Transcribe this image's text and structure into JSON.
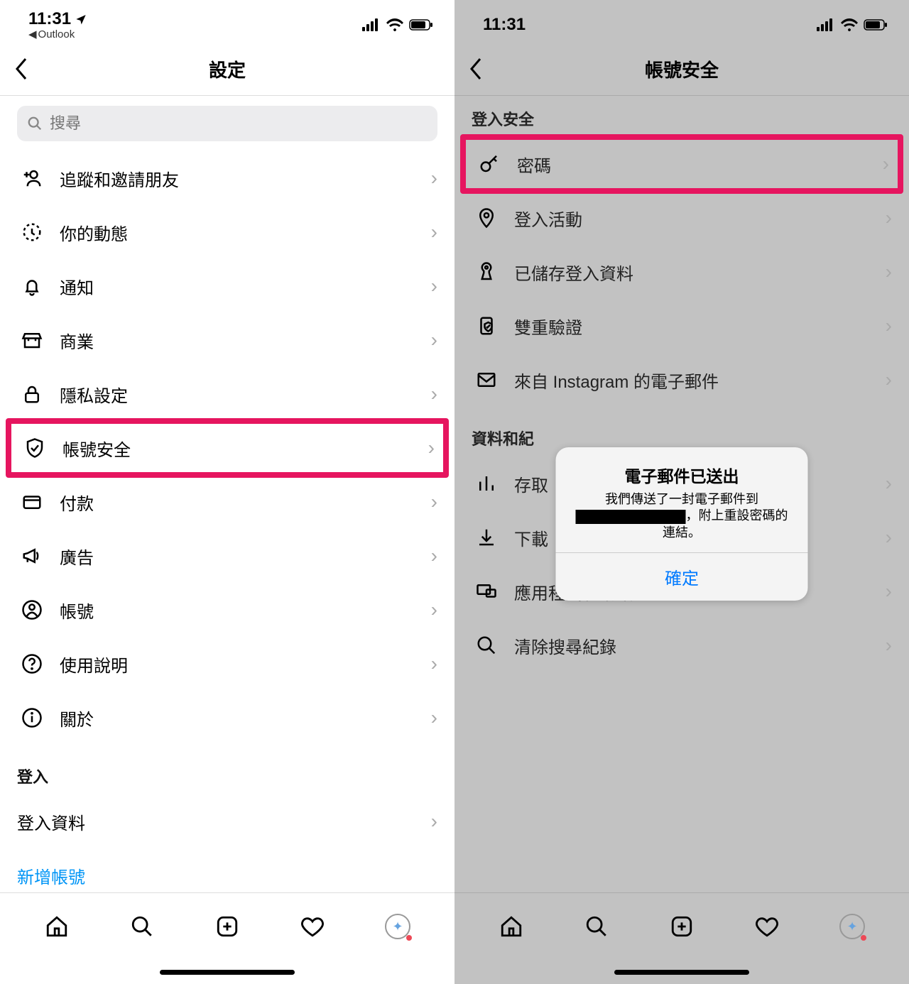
{
  "left": {
    "status": {
      "time": "11:31",
      "back_app": "Outlook"
    },
    "nav_title": "設定",
    "search_placeholder": "搜尋",
    "items": [
      {
        "icon": "add-user",
        "label": "追蹤和邀請朋友"
      },
      {
        "icon": "activity",
        "label": "你的動態"
      },
      {
        "icon": "bell",
        "label": "通知"
      },
      {
        "icon": "business",
        "label": "商業"
      },
      {
        "icon": "lock",
        "label": "隱私設定"
      },
      {
        "icon": "shield",
        "label": "帳號安全",
        "highlight": true
      },
      {
        "icon": "card",
        "label": "付款"
      },
      {
        "icon": "megaphone",
        "label": "廣告"
      },
      {
        "icon": "user",
        "label": "帳號"
      },
      {
        "icon": "help",
        "label": "使用說明"
      },
      {
        "icon": "info",
        "label": "關於"
      }
    ],
    "login_section": "登入",
    "login_info": "登入資料",
    "add_account": "新增帳號"
  },
  "right": {
    "status": {
      "time": "11:31"
    },
    "nav_title": "帳號安全",
    "section1": "登入安全",
    "items1": [
      {
        "icon": "key",
        "label": "密碼",
        "highlight": true
      },
      {
        "icon": "pin",
        "label": "登入活動"
      },
      {
        "icon": "keyhole",
        "label": "已儲存登入資料"
      },
      {
        "icon": "2fa",
        "label": "雙重驗證"
      },
      {
        "icon": "mail",
        "label": "來自 Instagram 的電子郵件"
      }
    ],
    "section2_partial": "資料和紀",
    "items2": [
      {
        "icon": "bars",
        "label": "存取"
      },
      {
        "icon": "download",
        "label": "下載"
      },
      {
        "icon": "apps",
        "label": "應用程式和網站"
      },
      {
        "icon": "search",
        "label": "清除搜尋紀錄"
      }
    ],
    "alert": {
      "title": "電子郵件已送出",
      "msg_pre": "我們傳送了一封電子郵件到",
      "msg_post": "，附上重設密碼的連結。",
      "button": "確定"
    }
  }
}
